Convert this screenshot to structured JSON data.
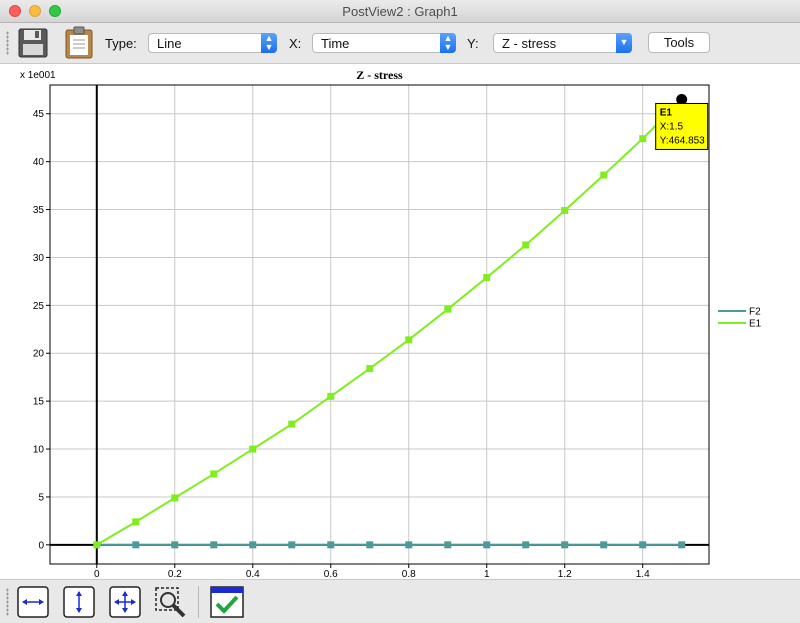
{
  "window": {
    "title": "PostView2 : Graph1"
  },
  "toolbar": {
    "type_label": "Type:",
    "type_value": "Line",
    "x_label": "X:",
    "x_value": "Time",
    "y_label": "Y:",
    "y_value": "Z - stress",
    "tools_label": "Tools",
    "icons": [
      "save-icon",
      "clipboard-icon"
    ]
  },
  "bottom_toolbar": {
    "icons": [
      "zoom-width-icon",
      "zoom-height-icon",
      "zoom-fit-icon",
      "zoom-select-icon",
      "apply-checkmark-icon"
    ]
  },
  "chart_data": {
    "type": "line",
    "title": "Z - stress",
    "y_multiplier": "x 1e001",
    "xlim": [
      -0.12,
      1.57
    ],
    "ylim": [
      -2,
      48
    ],
    "x_ticks": [
      "0",
      "0.2",
      "0.4",
      "0.6",
      "0.8",
      "1",
      "1.2",
      "1.4"
    ],
    "y_ticks": [
      "0",
      "5",
      "10",
      "15",
      "20",
      "25",
      "30",
      "35",
      "40",
      "45"
    ],
    "x": [
      0,
      0.1,
      0.2,
      0.3,
      0.4,
      0.5,
      0.6,
      0.7,
      0.8,
      0.9,
      1.0,
      1.1,
      1.2,
      1.3,
      1.4,
      1.5
    ],
    "series": [
      {
        "name": "F2",
        "color": "#4d9a99",
        "values": [
          0,
          0,
          0,
          0,
          0,
          0,
          0,
          0,
          0,
          0,
          0,
          0,
          0,
          0,
          0,
          0
        ]
      },
      {
        "name": "E1",
        "color": "#7fee1d",
        "values": [
          0,
          2.4,
          4.9,
          7.4,
          10.0,
          12.6,
          15.5,
          18.4,
          21.4,
          24.6,
          27.9,
          31.3,
          34.9,
          38.6,
          42.4,
          46.49
        ]
      }
    ],
    "legend_position": "right",
    "grid": true,
    "tooltip": {
      "series": "E1",
      "x_text": "X:1.5",
      "y_text": "Y:464.853"
    }
  }
}
